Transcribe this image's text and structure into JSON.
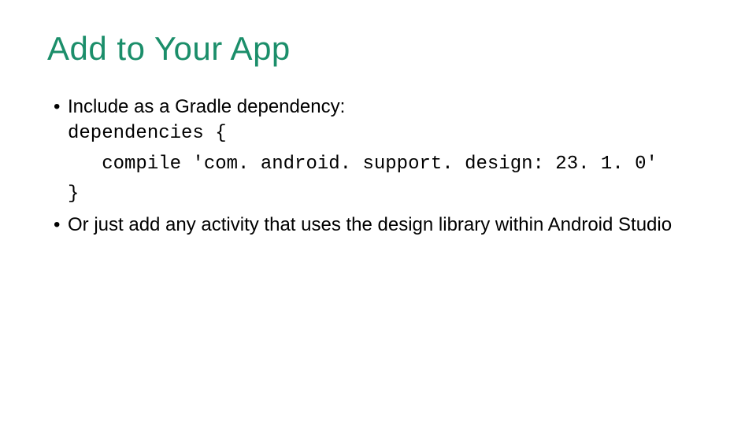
{
  "title": "Add to Your App",
  "bullet1": "Include as a Gradle dependency:",
  "code_line1": "dependencies {",
  "code_line2": "   compile 'com. android. support. design: 23. 1. 0'",
  "code_line3": "}",
  "bullet2": "Or just add any activity that uses the design library within Android Studio"
}
